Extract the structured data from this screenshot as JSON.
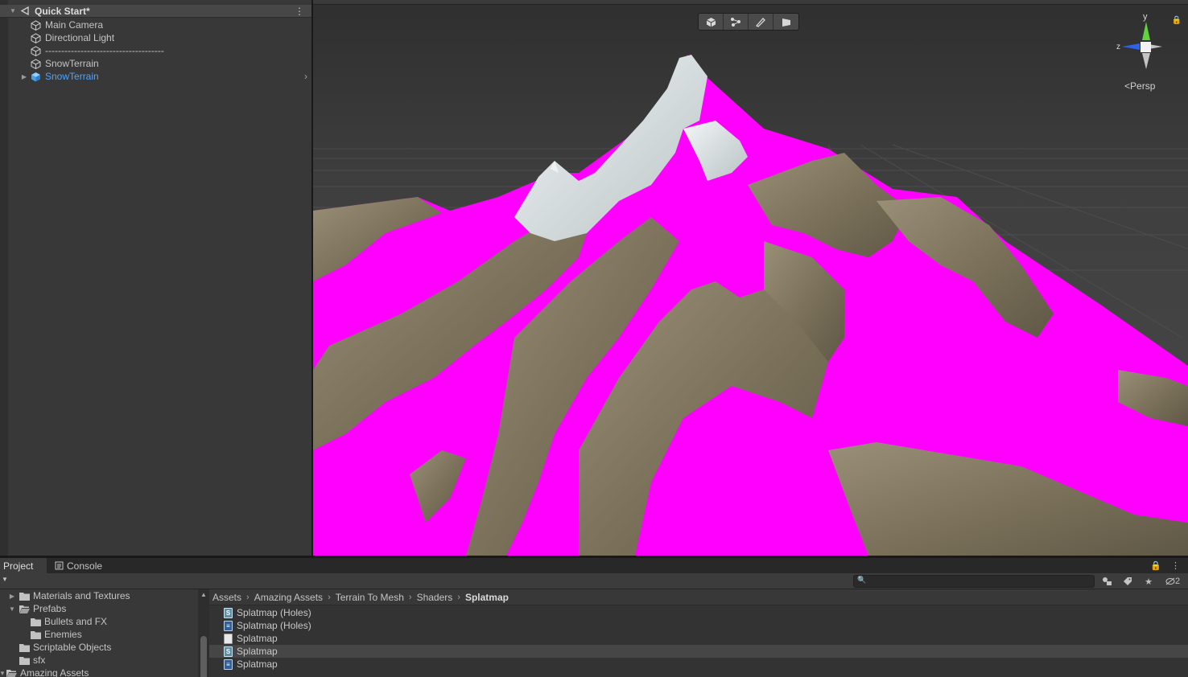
{
  "hierarchy": {
    "scene_name": "Quick Start*",
    "items": [
      {
        "label": "Main Camera",
        "icon": "gameobject-icon"
      },
      {
        "label": "Directional Light",
        "icon": "gameobject-icon"
      },
      {
        "label": "-------------------------------------",
        "icon": "gameobject-icon"
      },
      {
        "label": "SnowTerrain",
        "icon": "gameobject-icon"
      },
      {
        "label": "SnowTerrain",
        "icon": "prefab-icon"
      }
    ]
  },
  "scene_view": {
    "projection_label": "Persp",
    "gizmo_axis_z": "z",
    "gizmo_axis_y": "y",
    "overlay_tools": [
      "shaded-cube-icon",
      "move-nodes-icon",
      "sculpt-brush-icon",
      "flag-icon"
    ]
  },
  "project": {
    "tabs": [
      "Project",
      "Console"
    ],
    "hidden_count": "2",
    "tree": [
      {
        "label": "Materials and Textures",
        "indent": 1,
        "expanded": false
      },
      {
        "label": "Prefabs",
        "indent": 1,
        "expanded": true
      },
      {
        "label": "Bullets and FX",
        "indent": 2,
        "expanded": null
      },
      {
        "label": "Enemies",
        "indent": 2,
        "expanded": null
      },
      {
        "label": "Scriptable Objects",
        "indent": 1,
        "expanded": null
      },
      {
        "label": "sfx",
        "indent": 1,
        "expanded": null
      },
      {
        "label": "Amazing Assets",
        "indent": 0,
        "expanded": true
      }
    ],
    "breadcrumb": [
      "Assets",
      "Amazing Assets",
      "Terrain To Mesh",
      "Shaders",
      "Splatmap"
    ],
    "files": [
      {
        "label": "Splatmap (Holes)",
        "icon": "shader-icon",
        "selected": false
      },
      {
        "label": "Splatmap (Holes)",
        "icon": "shadergraph-icon",
        "selected": false
      },
      {
        "label": "Splatmap",
        "icon": "text-file-icon",
        "selected": false
      },
      {
        "label": "Splatmap",
        "icon": "shader-icon",
        "selected": true
      },
      {
        "label": "Splatmap",
        "icon": "shadergraph-icon",
        "selected": false
      }
    ]
  },
  "colors": {
    "missing_material": "#ff00ff",
    "rock": "#7d735c",
    "snow": "#dfe6e8",
    "selection_blue": "#4fa3ff"
  }
}
